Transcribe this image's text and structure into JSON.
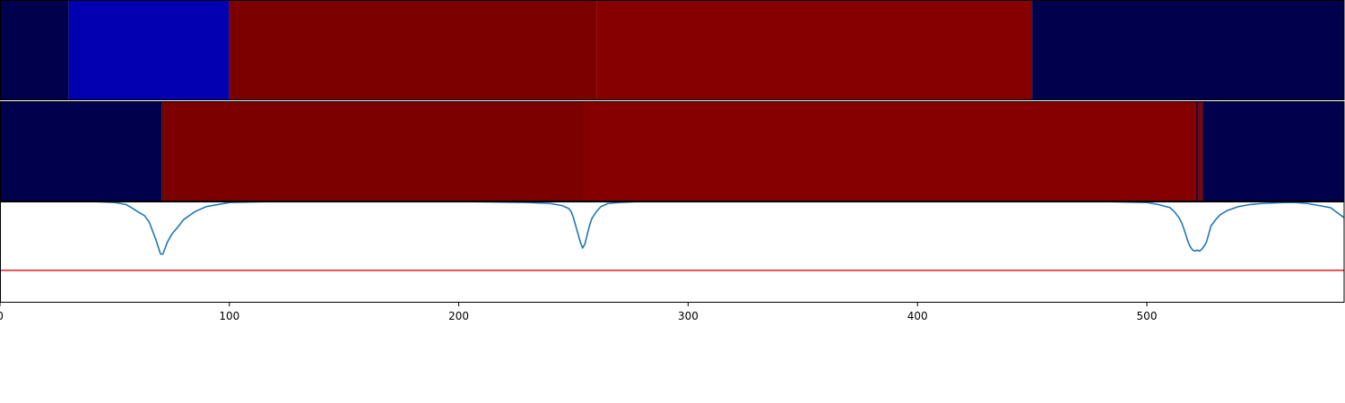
{
  "chart_data": [
    {
      "type": "heatmap",
      "segments": [
        {
          "start": 0,
          "end": 30,
          "color": "#00004c"
        },
        {
          "start": 30,
          "end": 100,
          "color": "#0000b0"
        },
        {
          "start": 100,
          "end": 260,
          "color": "#7d0000"
        },
        {
          "start": 260,
          "end": 450,
          "color": "#870000"
        },
        {
          "start": 450,
          "end": 586,
          "color": "#00004c"
        }
      ],
      "xlim": [
        0,
        586
      ]
    },
    {
      "type": "heatmap",
      "segments": [
        {
          "start": 0,
          "end": 70.5,
          "color": "#00004c"
        },
        {
          "start": 70.5,
          "end": 71.5,
          "color": "#5a0000"
        },
        {
          "start": 71.5,
          "end": 254.5,
          "color": "#7d0000"
        },
        {
          "start": 254.5,
          "end": 521.5,
          "color": "#870000"
        },
        {
          "start": 521.5,
          "end": 522.5,
          "color": "#2a0030"
        },
        {
          "start": 522.5,
          "end": 523.5,
          "color": "#870000"
        },
        {
          "start": 523.5,
          "end": 524.5,
          "color": "#5a0000"
        },
        {
          "start": 524.5,
          "end": 586,
          "color": "#00004c"
        }
      ],
      "xlim": [
        0,
        586
      ]
    },
    {
      "type": "line",
      "series": [
        {
          "color": "#1f77b4",
          "x": [
            0,
            20,
            40,
            50,
            55,
            58,
            60,
            63,
            65,
            66,
            67,
            68,
            69,
            70,
            71,
            72,
            73,
            75,
            78,
            80,
            85,
            90,
            100,
            120,
            150,
            200,
            230,
            240,
            245,
            248,
            249,
            250,
            251,
            252,
            253,
            254,
            255,
            256,
            257,
            258,
            260,
            262,
            265,
            270,
            280,
            300,
            350,
            400,
            450,
            480,
            500,
            505,
            510,
            512,
            514,
            515,
            516,
            517,
            518,
            519,
            520,
            521,
            522,
            523,
            524,
            525,
            526,
            527,
            528,
            530,
            532,
            535,
            540,
            545,
            550,
            560,
            565,
            570,
            575,
            580,
            586
          ],
          "y": [
            1.0,
            1.0,
            1.0,
            0.99,
            0.97,
            0.93,
            0.9,
            0.86,
            0.8,
            0.74,
            0.68,
            0.62,
            0.55,
            0.48,
            0.48,
            0.54,
            0.6,
            0.68,
            0.76,
            0.82,
            0.9,
            0.95,
            0.99,
            1.0,
            1.0,
            1.0,
            0.99,
            0.98,
            0.96,
            0.93,
            0.9,
            0.84,
            0.76,
            0.68,
            0.6,
            0.54,
            0.58,
            0.67,
            0.76,
            0.83,
            0.9,
            0.95,
            0.98,
            0.99,
            1.0,
            1.0,
            1.0,
            1.0,
            1.0,
            1.0,
            0.99,
            0.97,
            0.94,
            0.9,
            0.84,
            0.8,
            0.74,
            0.67,
            0.6,
            0.55,
            0.52,
            0.51,
            0.52,
            0.51,
            0.53,
            0.56,
            0.6,
            0.68,
            0.76,
            0.82,
            0.87,
            0.91,
            0.95,
            0.97,
            0.98,
            0.99,
            0.99,
            0.98,
            0.96,
            0.94,
            0.84
          ]
        },
        {
          "color": "#e31a1c",
          "x": [
            0,
            586
          ],
          "y": [
            0.32,
            0.32
          ]
        }
      ],
      "ylim": [
        0,
        1.0
      ],
      "xlim": [
        0,
        586
      ],
      "xticks": [
        0,
        100,
        200,
        300,
        400,
        500
      ]
    }
  ]
}
